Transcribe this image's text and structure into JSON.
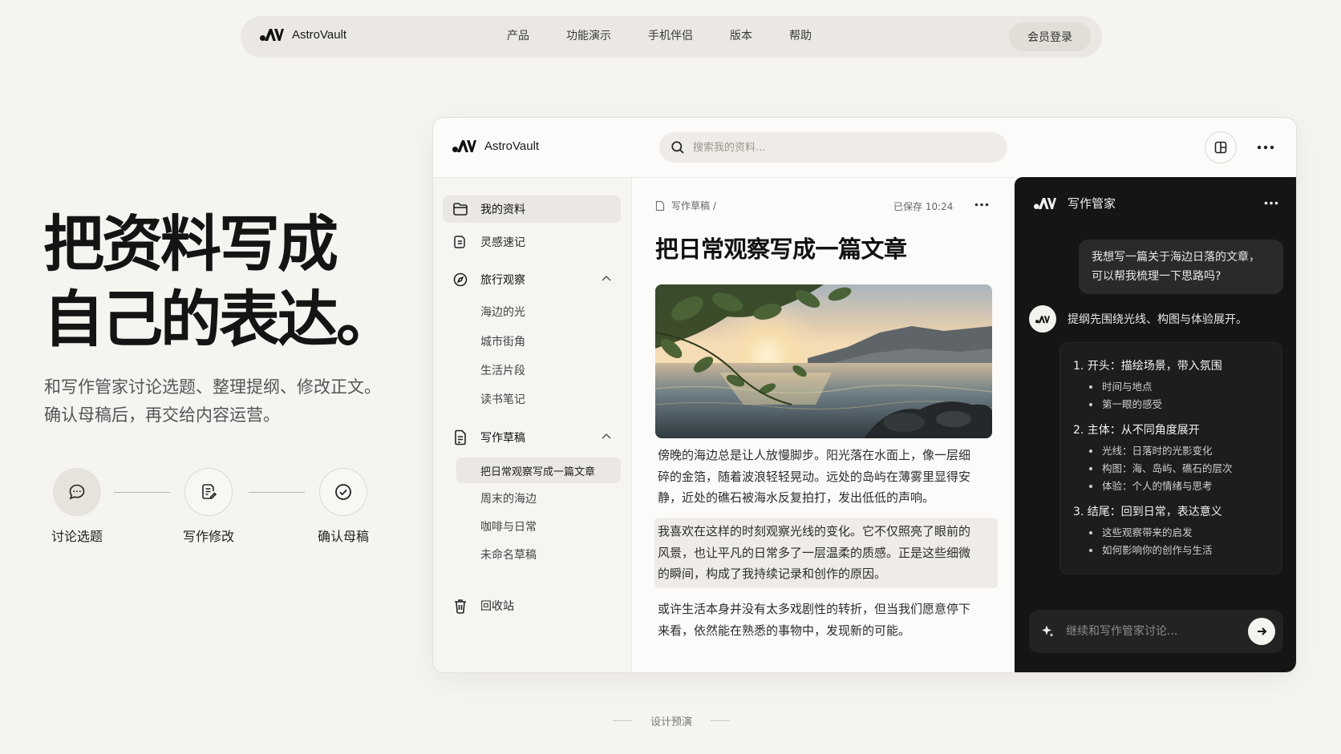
{
  "brand": {
    "name": "AstroVault"
  },
  "topnav": {
    "links": [
      "产品",
      "功能演示",
      "手机伴侣",
      "版本",
      "帮助"
    ],
    "login_label": "会员登录"
  },
  "hero": {
    "title_line1": "把资料写成",
    "title_line2": "自己的表达。",
    "subtitle_line1": "和写作管家讨论选题、整理提纲、修改正文。",
    "subtitle_line2": "确认母稿后，再交给内容运营。",
    "steps": [
      {
        "label": "讨论选题",
        "icon": "chat-bubble-icon"
      },
      {
        "label": "写作修改",
        "icon": "edit-document-icon"
      },
      {
        "label": "确认母稿",
        "icon": "check-circle-icon"
      }
    ]
  },
  "app": {
    "search": {
      "placeholder": "搜索我的资料..."
    },
    "sidebar": {
      "my_materials": "我的资料",
      "inspiration": "灵感速记",
      "travel": {
        "label": "旅行观察",
        "children": [
          "海边的光",
          "城市街角",
          "生活片段",
          "读书笔记"
        ]
      },
      "drafts": {
        "label": "写作草稿",
        "children": [
          "把日常观察写成一篇文章",
          "周末的海边",
          "咖啡与日常",
          "未命名草稿"
        ]
      },
      "trash": "回收站"
    },
    "doc": {
      "breadcrumb": "写作草稿 /",
      "saved": "已保存 10:24",
      "title": "把日常观察写成一篇文章",
      "image": "sunset-sea-photo",
      "paragraphs": [
        [
          "傍晚的海边总是让人放慢脚步。阳光落在水面上，像一层细",
          "碎的金箔，随着波浪轻轻晃动。远处的岛屿在薄雾里显得安",
          "静，近处的礁石被海水反复拍打，发出低低的声响。"
        ],
        [
          "我喜欢在这样的时刻观察光线的变化。它不仅照亮了眼前的",
          "风景，也让平凡的日常多了一层温柔的质感。正是这些细微",
          "的瞬间，构成了我持续记录和创作的原因。"
        ],
        [
          "或许生活本身并没有太多戏剧性的转折，但当我们愿意停下",
          "来看，依然能在熟悉的事物中，发现新的可能。"
        ]
      ]
    },
    "assistant": {
      "title": "写作管家",
      "user_message_line1": "我想写一篇关于海边日落的文章，",
      "user_message_line2": "可以帮我梳理一下思路吗?",
      "bot_message": "提纲先围绕光线、构图与体验展开。",
      "outline": [
        {
          "heading": "1. 开头：描绘场景，带入氛围",
          "items": [
            "时间与地点",
            "第一眼的感受"
          ]
        },
        {
          "heading": "2. 主体：从不同角度展开",
          "items": [
            "光线：日落时的光影变化",
            "构图：海、岛屿、礁石的层次",
            "体验：个人的情绪与思考"
          ]
        },
        {
          "heading": "3. 结尾：回到日常，表达意义",
          "items": [
            "这些观察带来的启发",
            "如何影响你的创作与生活"
          ]
        }
      ],
      "composer_placeholder": "继续和写作管家讨论..."
    }
  },
  "footer": {
    "note": "设计预演"
  },
  "colors": {
    "background": "#f6f4f0",
    "assistant_panel": "#151515",
    "accent_dark": "#111111"
  }
}
